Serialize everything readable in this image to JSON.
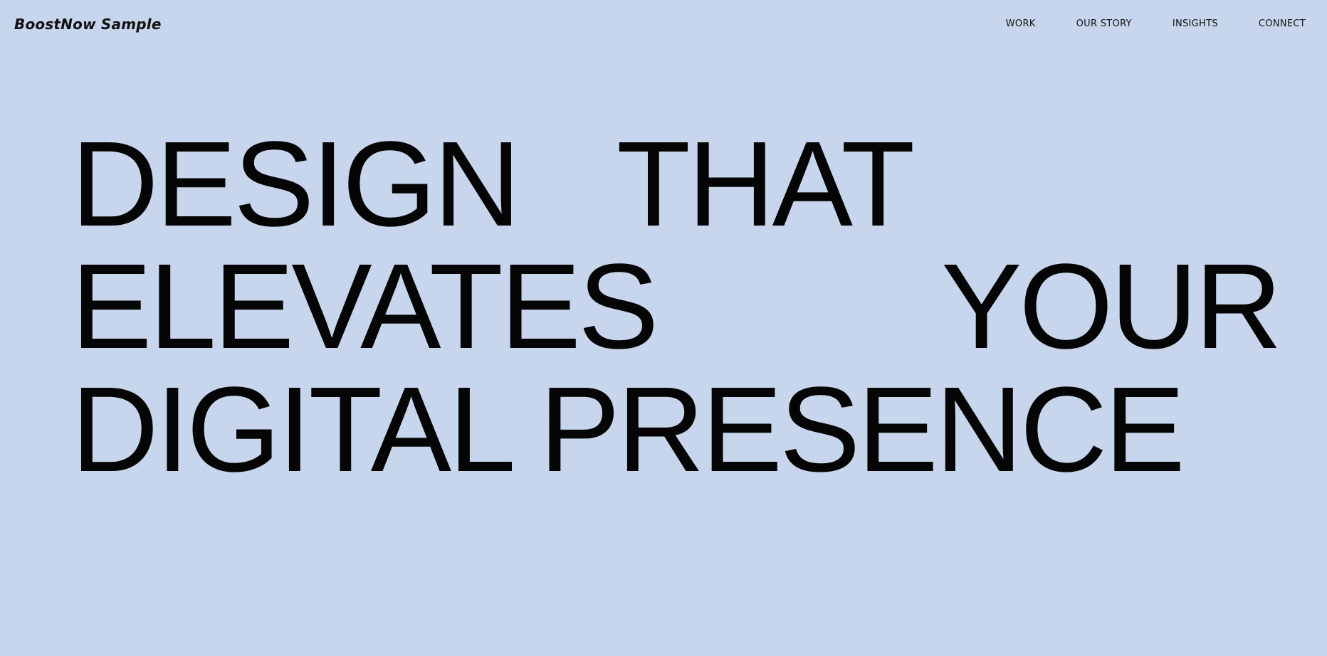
{
  "header": {
    "logo": "BoostNow Sample",
    "nav": [
      {
        "label": "WORK"
      },
      {
        "label": "OUR STORY"
      },
      {
        "label": "INSIGHTS"
      },
      {
        "label": "CONNECT"
      }
    ]
  },
  "hero": {
    "line1_left": "DESIGN",
    "line1_right": "THAT",
    "line2_left": "ELEVATES",
    "line2_right": "YOUR",
    "line3": "DIGITAL PRESENCE"
  },
  "colors": {
    "background": "#c8d6ed",
    "text": "#050505"
  }
}
